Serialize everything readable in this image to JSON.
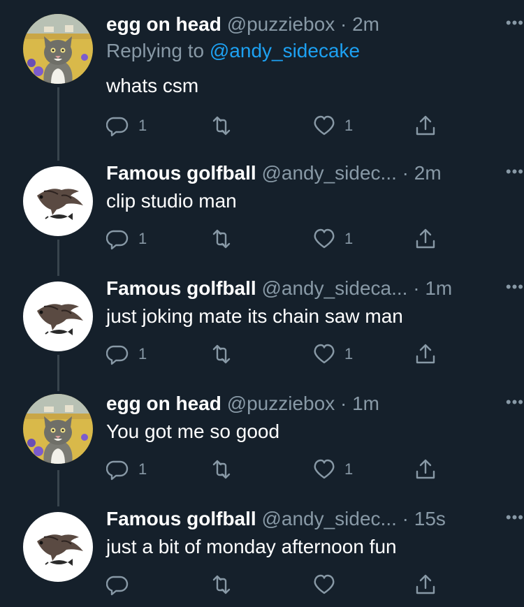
{
  "tweets": [
    {
      "name": "egg on head",
      "handle": "@puzziebox",
      "dot": "·",
      "time": "2m",
      "reply_prefix": "Replying to",
      "reply_mention": "@andy_sidecake",
      "text": "whats csm",
      "reply_count": "1",
      "like_count": "1",
      "avatar": "cat-avatar"
    },
    {
      "name": "Famous golfball",
      "handle": "@andy_sidec...",
      "dot": "·",
      "time": "2m",
      "text": "clip studio man",
      "reply_count": "1",
      "like_count": "1",
      "avatar": "bird-avatar"
    },
    {
      "name": "Famous golfball",
      "handle": "@andy_sideca...",
      "dot": "·",
      "time": "1m",
      "text": "just joking mate its chain saw man",
      "reply_count": "1",
      "like_count": "1",
      "avatar": "bird-avatar"
    },
    {
      "name": "egg on head",
      "handle": "@puzziebox",
      "dot": "·",
      "time": "1m",
      "text": "You got me so good",
      "reply_count": "1",
      "like_count": "1",
      "avatar": "cat-avatar"
    },
    {
      "name": "Famous golfball",
      "handle": "@andy_sidec...",
      "dot": "·",
      "time": "15s",
      "text": "just a bit of monday afternoon fun",
      "reply_count": "",
      "like_count": "",
      "avatar": "bird-avatar"
    }
  ],
  "icons": {
    "reply": "reply-icon",
    "retweet": "retweet-icon",
    "like": "heart-icon",
    "share": "share-icon",
    "more": "more-icon"
  },
  "colors": {
    "background": "#15202b",
    "muted": "#8899a6",
    "link": "#1da1f2",
    "thread_line": "#38444d"
  }
}
